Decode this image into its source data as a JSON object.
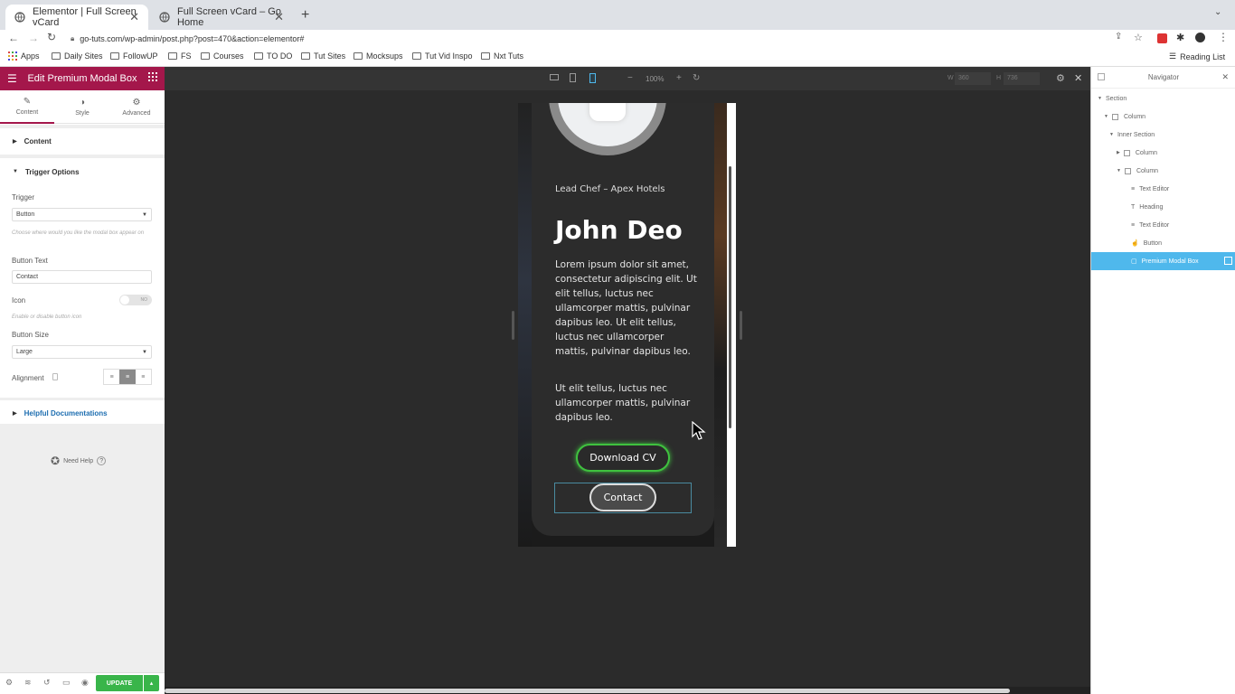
{
  "browser": {
    "tabs": [
      {
        "title": "Elementor | Full Screen vCard"
      },
      {
        "title": "Full Screen vCard – Go Home"
      }
    ],
    "url": "go-tuts.com/wp-admin/post.php?post=470&action=elementor#",
    "bookmarks": [
      "Apps",
      "Daily Sites",
      "FollowUP",
      "FS",
      "Courses",
      "TO DO",
      "Tut Sites",
      "Mocksups",
      "Tut Vid Inspo",
      "Nxt Tuts"
    ],
    "reading_list": "Reading List"
  },
  "panel": {
    "title": "Edit Premium Modal Box",
    "tabs": [
      "Content",
      "Style",
      "Advanced"
    ],
    "sections": {
      "content": "Content",
      "trigger_options": "Trigger Options",
      "helpful_docs": "Helpful Documentations"
    },
    "fields": {
      "trigger_label": "Trigger",
      "trigger_value": "Button",
      "trigger_hint": "Choose where would you like the modal box appear on",
      "button_text_label": "Button Text",
      "button_text_value": "Contact",
      "icon_label": "Icon",
      "icon_toggle": "NO",
      "icon_hint": "Enable or disable button icon",
      "button_size_label": "Button Size",
      "button_size_value": "Large",
      "alignment_label": "Alignment"
    },
    "need_help": "Need Help",
    "update_button": "UPDATE"
  },
  "canvas_toolbar": {
    "zoom": "100%",
    "w_label": "W",
    "w_value": "360",
    "h_label": "H",
    "h_value": "736"
  },
  "preview": {
    "subtitle": "Lead Chef – Apex Hotels",
    "name": "John Deo",
    "para1": "Lorem ipsum dolor sit amet, consectetur adipiscing elit. Ut elit tellus, luctus nec ullamcorper mattis, pulvinar dapibus leo. Ut elit tellus, luctus nec ullamcorper mattis, pulvinar dapibus leo.",
    "para2": "Ut elit tellus, luctus nec ullamcorper mattis, pulvinar dapibus leo.",
    "download_button": "Download CV",
    "contact_button": "Contact",
    "accent_color": "#3fc13f"
  },
  "navigator": {
    "title": "Navigator",
    "items": [
      "Section",
      "Column",
      "Inner Section",
      "Column",
      "Column",
      "Text Editor",
      "Heading",
      "Text Editor",
      "Button",
      "Premium Modal Box"
    ]
  },
  "colors": {
    "elementor_brand": "#a4174b",
    "selection": "#4fb8ec",
    "update_green": "#39b54a"
  }
}
